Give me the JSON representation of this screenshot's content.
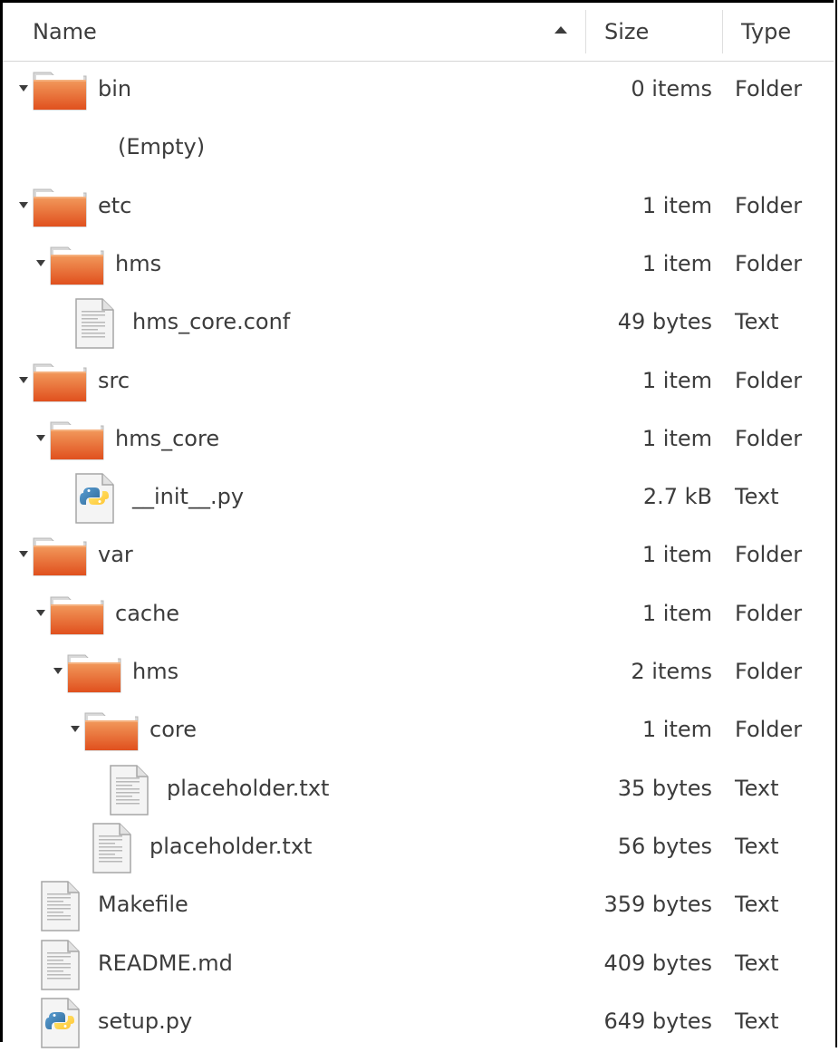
{
  "columns": {
    "name": "Name",
    "size": "Size",
    "type": "Type"
  },
  "rows": [
    {
      "name": "bin",
      "size": "0 items",
      "type": "Folder",
      "kind": "folder",
      "depth": 0,
      "expanded": true
    },
    {
      "name": "(Empty)",
      "size": "",
      "type": "",
      "kind": "empty",
      "depth": 1
    },
    {
      "name": "etc",
      "size": "1 item",
      "type": "Folder",
      "kind": "folder",
      "depth": 0,
      "expanded": true
    },
    {
      "name": "hms",
      "size": "1 item",
      "type": "Folder",
      "kind": "folder",
      "depth": 1,
      "expanded": true
    },
    {
      "name": "hms_core.conf",
      "size": "49 bytes",
      "type": "Text",
      "kind": "text",
      "depth": 2
    },
    {
      "name": "src",
      "size": "1 item",
      "type": "Folder",
      "kind": "folder",
      "depth": 0,
      "expanded": true
    },
    {
      "name": "hms_core",
      "size": "1 item",
      "type": "Folder",
      "kind": "folder",
      "depth": 1,
      "expanded": true
    },
    {
      "name": "__init__.py",
      "size": "2.7 kB",
      "type": "Text",
      "kind": "python",
      "depth": 2
    },
    {
      "name": "var",
      "size": "1 item",
      "type": "Folder",
      "kind": "folder",
      "depth": 0,
      "expanded": true
    },
    {
      "name": "cache",
      "size": "1 item",
      "type": "Folder",
      "kind": "folder",
      "depth": 1,
      "expanded": true
    },
    {
      "name": "hms",
      "size": "2 items",
      "type": "Folder",
      "kind": "folder",
      "depth": 2,
      "expanded": true
    },
    {
      "name": "core",
      "size": "1 item",
      "type": "Folder",
      "kind": "folder",
      "depth": 3,
      "expanded": true
    },
    {
      "name": "placeholder.txt",
      "size": "35 bytes",
      "type": "Text",
      "kind": "text",
      "depth": 4
    },
    {
      "name": "placeholder.txt",
      "size": "56 bytes",
      "type": "Text",
      "kind": "text",
      "depth": 3
    },
    {
      "name": "Makefile",
      "size": "359 bytes",
      "type": "Text",
      "kind": "text",
      "depth": 0
    },
    {
      "name": "README.md",
      "size": "409 bytes",
      "type": "Text",
      "kind": "text",
      "depth": 0
    },
    {
      "name": "setup.py",
      "size": "649 bytes",
      "type": "Text",
      "kind": "python",
      "depth": 0
    }
  ],
  "colors": {
    "folder_top": "#f29a5c",
    "folder_bottom": "#e0501e",
    "text": "#3c3c3c"
  },
  "icons": {
    "folder": "folder-icon",
    "text": "text-file-icon",
    "python": "python-file-icon",
    "expander": "expander-down-icon"
  }
}
